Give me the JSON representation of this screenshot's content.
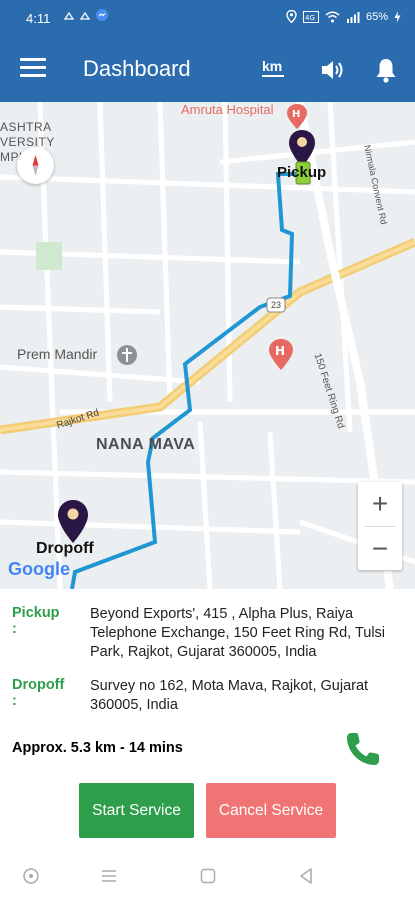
{
  "status_bar": {
    "time": "4:11",
    "battery": "65%"
  },
  "app_bar": {
    "title": "Dashboard",
    "km_label": "km"
  },
  "map": {
    "labels": {
      "hospital": "Amruta Hospital",
      "university_line1": "ASHTRA",
      "university_line2": "VERSITY",
      "university_line3": "MPUS",
      "prem_mandir": "Prem Mandir",
      "rajkot_rd": "Rajkot Rd",
      "nana_mava": "NANA MAVA",
      "ring_rd": "150 Feet Ring Rd",
      "convent_rd": "Nirmala Convent Rd",
      "highway_shield": "23",
      "pickup": "Pickup",
      "dropoff": "Dropoff",
      "google": "Google"
    },
    "zoom_in": "+",
    "zoom_out": "−"
  },
  "trip": {
    "pickup_label": "Pickup :",
    "pickup_address": "Beyond Exports', 415 , Alpha Plus, Raiya Telephone Exchange, 150 Feet Ring Rd, Tulsi Park, Rajkot, Gujarat 360005, India",
    "dropoff_label": "Dropoff :",
    "dropoff_address": "Survey no 162, Mota Mava, Rajkot, Gujarat 360005, India",
    "approx": "Approx. 5.3 km - 14 mins"
  },
  "actions": {
    "start_label": "Start Service",
    "cancel_label": "Cancel Service"
  },
  "colors": {
    "app_bar": "#2a6cad",
    "accent_green": "#2e9e4b",
    "cancel_red": "#f07474",
    "route_blue": "#2196d3"
  }
}
